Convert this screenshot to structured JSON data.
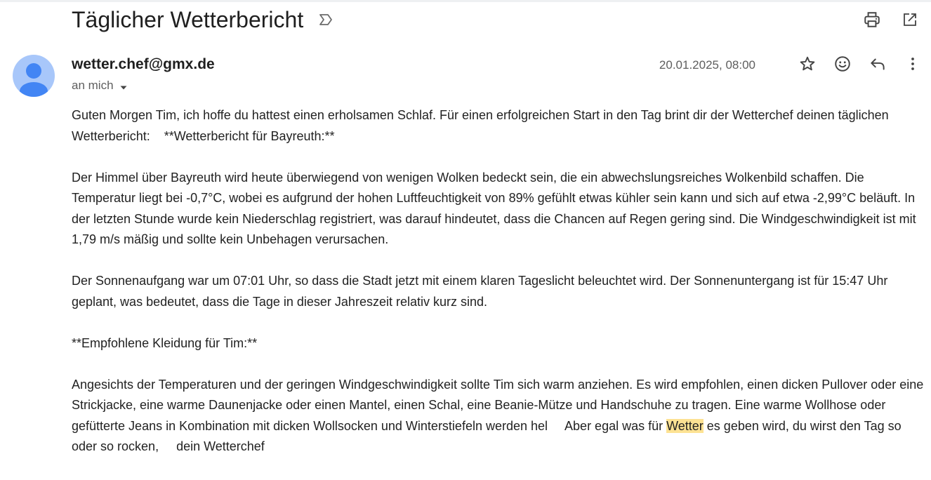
{
  "email": {
    "subject": "Täglicher Wetterbericht",
    "sender": "wetter.chef@gmx.de",
    "recipient": "an mich",
    "date": "20.01.2025, 08:00"
  },
  "icons": {
    "label": "label-important-icon",
    "print": "print-icon",
    "open_new": "open-in-new-window-icon",
    "star": "star-icon",
    "emoji": "emoji-reaction-icon",
    "reply": "reply-icon",
    "more": "more-vert-icon",
    "avatar": "person-avatar-icon",
    "caret": "caret-down-icon"
  },
  "colors": {
    "avatar_bg": "#a8c7fa",
    "avatar_fg": "#4285f4",
    "highlight": "#fde293"
  },
  "body": {
    "p1": "Guten Morgen Tim, ich hoffe du hattest einen erholsamen Schlaf. Für einen erfolgreichen Start in den Tag brint dir der Wetterchef deinen täglichen Wetterbericht:    **Wetterbericht für Bayreuth:**",
    "p2": "Der Himmel über Bayreuth wird heute überwiegend von wenigen Wolken bedeckt sein, die ein abwechslungsreiches Wolkenbild schaffen. Die Temperatur liegt bei -0,7°C, wobei es aufgrund der hohen Luftfeuchtigkeit von 89% gefühlt etwas kühler sein kann und sich auf etwa -2,99°C beläuft. In der letzten Stunde wurde kein Niederschlag registriert, was darauf hindeutet, dass die Chancen auf Regen gering sind. Die Windgeschwindigkeit ist mit 1,79 m/s mäßig und sollte kein Unbehagen verursachen.",
    "p3": "Der Sonnenaufgang war um 07:01 Uhr, so dass die Stadt jetzt mit einem klaren Tageslicht beleuchtet wird. Der Sonnenuntergang ist für 15:47 Uhr geplant, was bedeutet, dass die Tage in dieser Jahreszeit relativ kurz sind.",
    "p4": "**Empfohlene Kleidung für Tim:**",
    "p5_before": "Angesichts der Temperaturen und der geringen Windgeschwindigkeit sollte Tim sich warm anziehen. Es wird empfohlen, einen dicken Pullover oder eine Strickjacke, eine warme Daunenjacke oder einen Mantel, einen Schal, eine Beanie-Mütze und Handschuhe zu tragen. Eine warme Wollhose oder gefütterte Jeans in Kombination mit dicken Wollsocken und Winterstiefeln werden hel     Aber egal was für ",
    "p5_highlight": "Wetter",
    "p5_after": " es geben wird, du wirst den Tag so oder so rocken,     dein Wetterchef"
  }
}
